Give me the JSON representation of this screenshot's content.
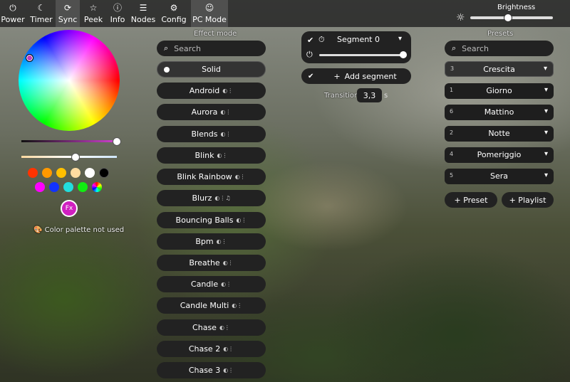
{
  "nav": {
    "tabs": [
      {
        "icon": "⏻",
        "label": "Power"
      },
      {
        "icon": "☾",
        "label": "Timer"
      },
      {
        "icon": "⟳",
        "label": "Sync"
      },
      {
        "icon": "☆",
        "label": "Peek"
      },
      {
        "icon": "ⓘ",
        "label": "Info"
      },
      {
        "icon": "☰",
        "label": "Nodes"
      },
      {
        "icon": "⚙",
        "label": "Config"
      },
      {
        "icon": "☺",
        "label": "PC Mode"
      }
    ],
    "brightness_label": "Brightness",
    "brightness_value": 0.45
  },
  "colors": {
    "swatches": [
      "#ff3300",
      "#ff9900",
      "#ffc000",
      "#ffdca0",
      "#ffffff",
      "#000000",
      "#ff00ff",
      "#1133ff",
      "#22dddd",
      "#11ee11"
    ],
    "fx_button": "Fx",
    "palette_note": "Color palette not used"
  },
  "effects": {
    "title": "Effect mode",
    "search_placeholder": "Search",
    "items": [
      {
        "label": "Solid",
        "flags": ""
      },
      {
        "label": "Android",
        "flags": "◐⋮"
      },
      {
        "label": "Aurora",
        "flags": "◐⋮"
      },
      {
        "label": "Blends",
        "flags": "◐⋮"
      },
      {
        "label": "Blink",
        "flags": "◐⋮"
      },
      {
        "label": "Blink Rainbow",
        "flags": "◐⋮"
      },
      {
        "label": "Blurz",
        "flags": "◐⋮♫"
      },
      {
        "label": "Bouncing Balls",
        "flags": "◐⋮"
      },
      {
        "label": "Bpm",
        "flags": "◐⋮"
      },
      {
        "label": "Breathe",
        "flags": "◐⋮"
      },
      {
        "label": "Candle",
        "flags": "◐⋮"
      },
      {
        "label": "Candle Multi",
        "flags": "◐⋮"
      },
      {
        "label": "Chase",
        "flags": "◐⋮"
      },
      {
        "label": "Chase 2",
        "flags": "◐⋮"
      },
      {
        "label": "Chase 3",
        "flags": "◐⋮"
      }
    ]
  },
  "segment": {
    "name": "Segment 0",
    "add_label": "Add segment",
    "transition_label": "Transition:",
    "transition_value": "3,3",
    "transition_unit": "s"
  },
  "presets": {
    "title": "Presets",
    "search_placeholder": "Search",
    "items": [
      {
        "id": "3",
        "name": "Crescita"
      },
      {
        "id": "1",
        "name": "Giorno"
      },
      {
        "id": "6",
        "name": "Mattino"
      },
      {
        "id": "2",
        "name": "Notte"
      },
      {
        "id": "4",
        "name": "Pomeriggio"
      },
      {
        "id": "5",
        "name": "Sera"
      }
    ],
    "add_preset": "+ Preset",
    "add_playlist": "+ Playlist"
  }
}
